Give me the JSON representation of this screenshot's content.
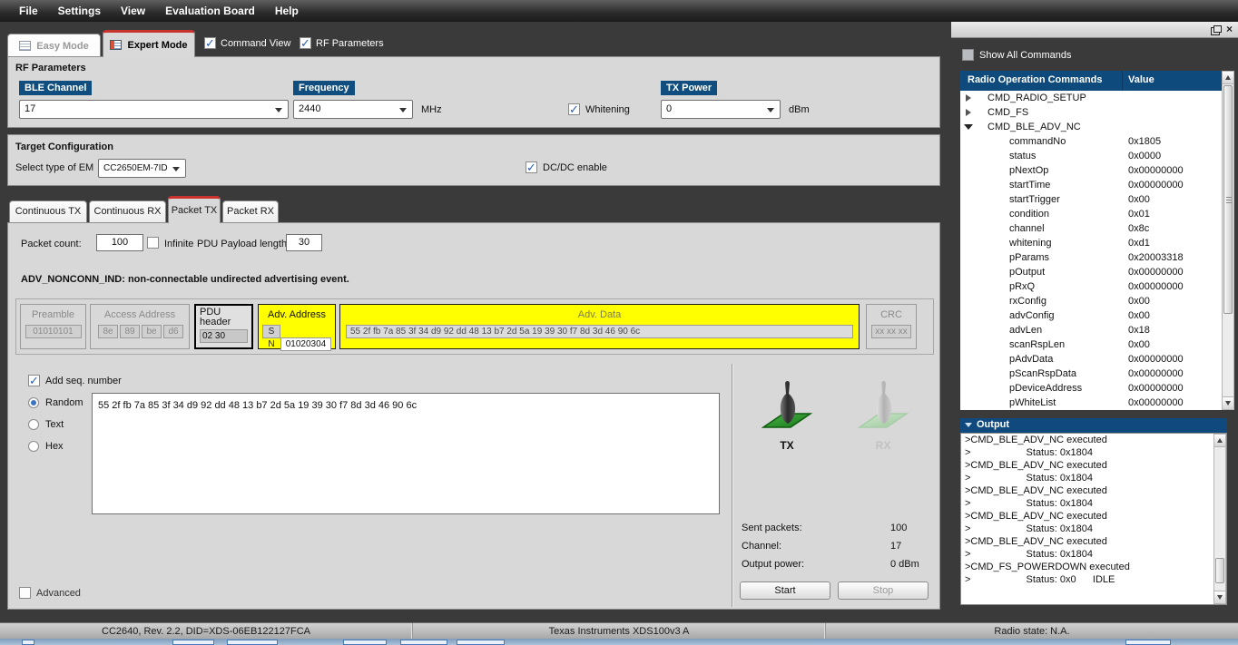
{
  "menu": {
    "items": [
      "File",
      "Settings",
      "View",
      "Evaluation Board",
      "Help"
    ]
  },
  "mode_tabs": {
    "easy": "Easy Mode",
    "expert": "Expert Mode"
  },
  "view_toggles": {
    "command_view": "Command View",
    "rf_parameters": "RF Parameters"
  },
  "rf": {
    "title": "RF Parameters",
    "ble_channel_label": "BLE Channel",
    "ble_channel_value": "17",
    "frequency_label": "Frequency",
    "frequency_value": "2440",
    "frequency_unit": "MHz",
    "whitening_label": "Whitening",
    "tx_power_label": "TX Power",
    "tx_power_value": "0",
    "tx_power_unit": "dBm"
  },
  "target": {
    "title": "Target Configuration",
    "em_label": "Select type of EM",
    "em_value": "CC2650EM-7ID",
    "dcdc_label": "DC/DC enable"
  },
  "packet_tabs": {
    "items": [
      "Continuous TX",
      "Continuous RX",
      "Packet TX",
      "Packet RX"
    ],
    "active": "Packet TX"
  },
  "packet_tx": {
    "packet_count_label": "Packet count:",
    "packet_count_value": "100",
    "infinite_label": "Infinite",
    "pdu_payload_label": "PDU Payload length:",
    "pdu_payload_value": "30",
    "adv_description": "ADV_NONCONN_IND: non-connectable undirected advertising event.",
    "diagram": {
      "preamble_label": "Preamble",
      "preamble_value": "01010101",
      "access_label": "Access Address",
      "access_bytes": [
        "8e",
        "89",
        "be",
        "d6"
      ],
      "pdu_header_label1": "PDU",
      "pdu_header_label2": "header",
      "pdu_header_value": "02 30",
      "adv_addr_label": "Adv. Address",
      "adv_addr_sn": "S N",
      "adv_addr_value": "01020304",
      "adv_data_label": "Adv. Data",
      "adv_data_value": "55 2f fb 7a 85 3f 34 d9 92 dd 48 13 b7 2d 5a 19 39 30 f7 8d 3d 46 90 6c",
      "crc_label": "CRC",
      "crc_value": "xx xx xx"
    },
    "add_seq_label": "Add seq. number",
    "payload_mode": {
      "options": [
        "Random",
        "Text",
        "Hex"
      ],
      "selected": "Random"
    },
    "payload_text": "55 2f fb 7a 85 3f 34 d9 92 dd 48 13 b7 2d 5a 19 39 30 f7 8d 3d 46 90 6c",
    "tx_label": "TX",
    "rx_label": "RX",
    "stats": [
      {
        "label": "Sent packets:",
        "value": "100"
      },
      {
        "label": "Channel:",
        "value": "17"
      },
      {
        "label": "Output power:",
        "value": "0 dBm"
      }
    ],
    "start_button": "Start",
    "stop_button": "Stop",
    "advanced_label": "Advanced"
  },
  "command_view": {
    "show_all_label": "Show All Commands",
    "columns": [
      "Radio Operation Commands",
      "Value"
    ],
    "rows": [
      {
        "arrow": "collapsed",
        "name": "CMD_RADIO_SETUP",
        "value": ""
      },
      {
        "arrow": "collapsed",
        "name": "CMD_FS",
        "value": ""
      },
      {
        "arrow": "expanded",
        "name": "CMD_BLE_ADV_NC",
        "value": ""
      },
      {
        "name": "commandNo",
        "value": "0x1805"
      },
      {
        "name": "status",
        "value": "0x0000"
      },
      {
        "name": "pNextOp",
        "value": "0x00000000"
      },
      {
        "name": "startTime",
        "value": "0x00000000"
      },
      {
        "name": "startTrigger",
        "value": "0x00"
      },
      {
        "name": "condition",
        "value": "0x01"
      },
      {
        "name": "channel",
        "value": "0x8c"
      },
      {
        "name": "whitening",
        "value": "0xd1"
      },
      {
        "name": "pParams",
        "value": "0x20003318"
      },
      {
        "name": "pOutput",
        "value": "0x00000000"
      },
      {
        "name": "pRxQ",
        "value": "0x00000000"
      },
      {
        "name": "rxConfig",
        "value": "0x00"
      },
      {
        "name": "advConfig",
        "value": "0x00"
      },
      {
        "name": "advLen",
        "value": "0x18"
      },
      {
        "name": "scanRspLen",
        "value": "0x00"
      },
      {
        "name": "pAdvData",
        "value": "0x00000000"
      },
      {
        "name": "pScanRspData",
        "value": "0x00000000"
      },
      {
        "name": "pDeviceAddress",
        "value": "0x00000000"
      },
      {
        "name": "pWhiteList",
        "value": "0x00000000"
      }
    ]
  },
  "output": {
    "title": "Output",
    "lines": [
      ">CMD_BLE_ADV_NC executed",
      ">                    Status: 0x1804",
      ">CMD_BLE_ADV_NC executed",
      ">                    Status: 0x1804",
      ">CMD_BLE_ADV_NC executed",
      ">                    Status: 0x1804",
      ">CMD_BLE_ADV_NC executed",
      ">                    Status: 0x1804",
      ">CMD_BLE_ADV_NC executed",
      ">                    Status: 0x1804",
      ">CMD_FS_POWERDOWN executed",
      ">                    Status: 0x0      IDLE"
    ]
  },
  "status_bar": {
    "device": "CC2640, Rev. 2.2, DID=XDS-06EB122127FCA",
    "debugger": "Texas Instruments XDS100v3 A",
    "radio_state": "Radio state: N.A."
  },
  "colors": {
    "accent_blue": "#0F4E7E",
    "highlight_yellow": "#FFFF00",
    "active_tab_red": "#C8332E",
    "tx_green": "#2E9E2E"
  }
}
